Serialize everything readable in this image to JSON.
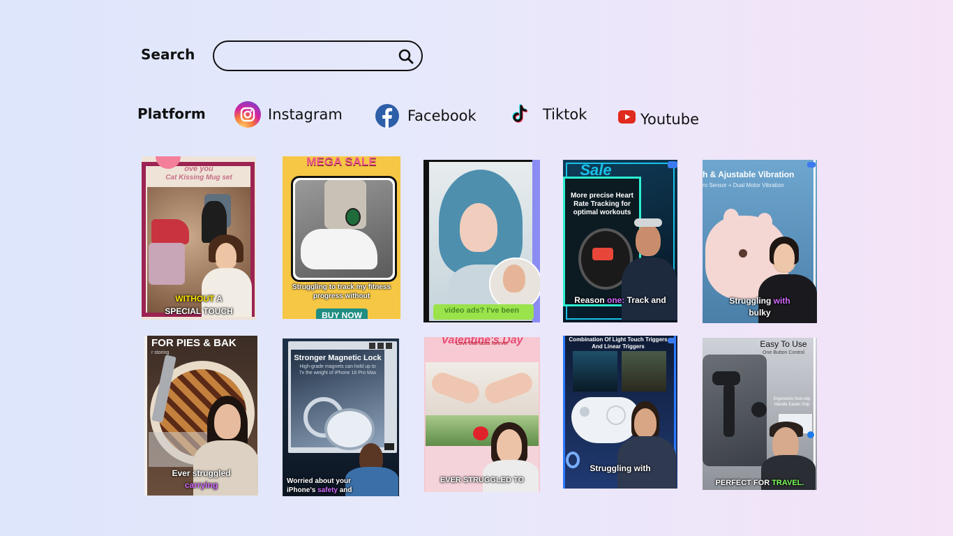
{
  "search": {
    "label": "Search",
    "value": "",
    "placeholder": ""
  },
  "platform": {
    "label": "Platform",
    "items": [
      {
        "name": "Instagram",
        "icon": "instagram-icon"
      },
      {
        "name": "Facebook",
        "icon": "facebook-icon"
      },
      {
        "name": "Tiktok",
        "icon": "tiktok-icon"
      },
      {
        "name": "Youtube",
        "icon": "youtube-icon"
      }
    ]
  },
  "cards": [
    {
      "top": "ove you",
      "top2": "Cat Kissing Mug set",
      "cap1": "WITHOUT",
      "cap1b": " A",
      "cap2": "SPECIAL TOUCH"
    },
    {
      "top": "MEGA SALE",
      "cap1": "Struggling to track my fitness",
      "cap2": "progress without",
      "cta": "BUY NOW"
    },
    {
      "cap1": "video ads? I've been"
    },
    {
      "top": "Sale",
      "promo": "More precise Heart Rate Tracking for optimal workouts",
      "cap1": "Reason ",
      "cap1b": "one:",
      "cap1c": " Track and"
    },
    {
      "top": "h & Ajustable Vibration",
      "top2": "ro Sensor + Dual Motor Vibration",
      "cap1": "Struggling ",
      "cap1b": "with",
      "cap2": "bulky"
    },
    {
      "top": "FOR PIES & BAK",
      "top2": "r storing",
      "cap1": "Ever struggled",
      "cap2": "carrying"
    },
    {
      "top": "Stronger Magnetic Lock",
      "top2": "High-grade magnets can hold up to 7x the weight of iPhone 16 Pro Max",
      "cap1": "Worried about your",
      "cap2a": "iPhone's ",
      "cap2b": "safety",
      "cap2c": " and"
    },
    {
      "top": "Valentine's Day",
      "top2": "Love that lasts forever",
      "cap1": "EVER STRUGGLED TO"
    },
    {
      "top": "Combination Of Light Touch Triggers And Linear Triggers",
      "cap1": "Struggling ",
      "cap1b": "with"
    },
    {
      "top": "Easy To Use",
      "top2": "One Button Control",
      "mid": "Ergonomic Non-slip Handle Easier Grip",
      "cap1": "PERFECT FOR ",
      "cap1b": "TRAVEL."
    }
  ]
}
